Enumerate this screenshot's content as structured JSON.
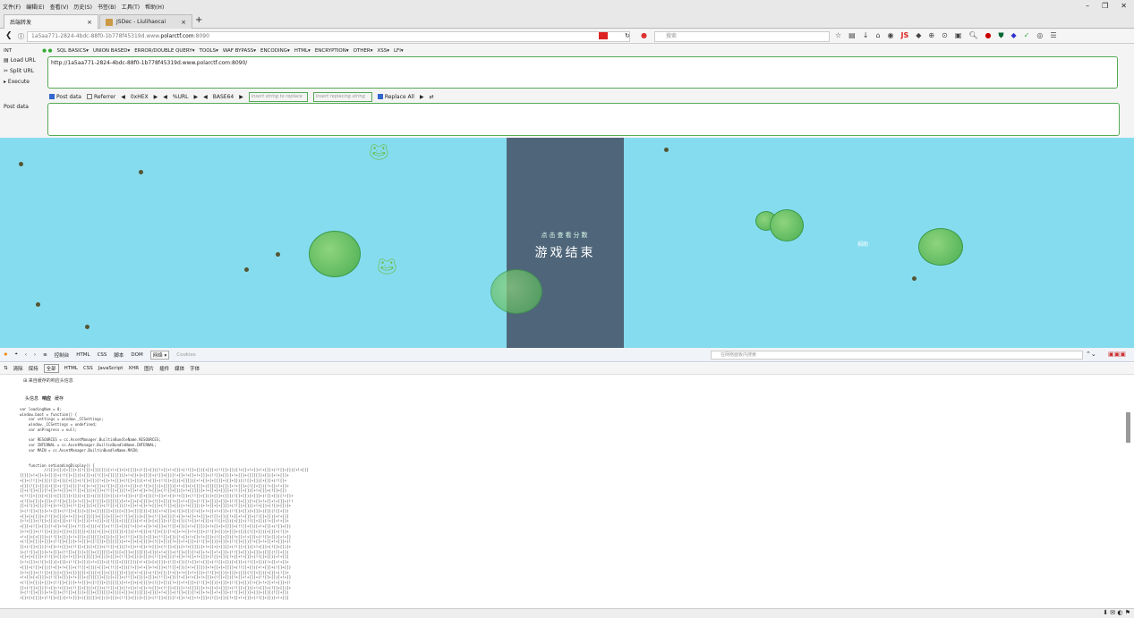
{
  "menubar": [
    "文件(F)",
    "编辑(E)",
    "查看(V)",
    "历史(S)",
    "书签(B)",
    "工具(T)",
    "帮助(H)"
  ],
  "window_controls": [
    "–",
    "❐",
    "✕"
  ],
  "tabs": [
    {
      "label": "后端转发",
      "active": true
    },
    {
      "label": "JSDec - Liulihaocai",
      "active": false
    }
  ],
  "nav": {
    "url_prefix": "1a5aa771-2824-4bdc-88f0-1b778f45319d.www.",
    "url_host": "polarctf.com",
    "url_suffix": ":8090",
    "search_placeholder": "搜索"
  },
  "hackbar": {
    "int_label": "INT",
    "menu": [
      "SQL BASICS▾",
      "UNION BASED▾",
      "ERROR/DOUBLE QUERY▾",
      "TOOLS▾",
      "WAF BYPASS▾",
      "ENCODING▾",
      "HTML▾",
      "ENCRYPTION▾",
      "OTHER▾",
      "XSS▾",
      "LFI▾"
    ],
    "load_url": "Load URL",
    "split_url": "Split URL",
    "execute": "Execute",
    "url_value": "http://1a5aa771-2824-4bdc-88f0-1b778f45319d.www.polarctf.com:8090/",
    "post_data_cb": "Post data",
    "referrer_cb": "Referrer",
    "hex": "0xHEX",
    "url_enc": "%URL",
    "base64": "BASE64",
    "insert_placeholder": "insert string to replace",
    "replacing_placeholder": "insert replacing string",
    "replace_all": "Replace All",
    "post_label": "Post data"
  },
  "game": {
    "score_hint": "点击查看分数",
    "game_over": "游戏结束",
    "side_label": "捐助"
  },
  "devtools": {
    "tabs": [
      "控制台",
      "HTML",
      "CSS",
      "脚本",
      "DOM",
      "网络 ▾",
      "Cookies"
    ],
    "active_tab": "网络 ▾",
    "search_placeholder": "在网络面板内搜索",
    "filters": [
      "清除",
      "保持",
      "全部",
      "HTML",
      "CSS",
      "JavaScript",
      "XHR",
      "图片",
      "插件",
      "媒体",
      "字体"
    ],
    "active_filter": "全部",
    "cache_note": "⊞ 来自缓存的响应头信息",
    "subtabs": [
      "头信息",
      "响应",
      "缓存"
    ],
    "active_subtab": "响应",
    "code": "var loadingNum = 0;\nwindow.boot = function() {\n    var settings = window._CCSettings;\n    window._CCSettings = undefined;\n    var onProgress = null;\n\n    var RESOURCES = cc.AssetManager.BuiltinBundleName.RESOURCES;\n    var INTERNAL = cc.AssetManager.BuiltinBundleName.INTERNAL;\n    var MAIN = cc.AssetManager.BuiltinBundleName.MAIN;\n\n\n    function setLoadingDisplay() {\n           //([]+[])[+[]]+([![]]+[][[]])[+!+[]+[+[]]]+(![]+[])[!+[]+!+[]]+(!![]+[])[+[]]+(!![]+[])[!+[]+!+[]+!+[]]+(!![]+[])[+!+[]]\n[[]][+!+[]+[+[]]]+(!![]+[])[+[]]+([![]]+[][[]])[+!+[]+[+[]]]+(![]+[])[!+[]+!+[]+!+[]]+(!![]+[])[+!+[]]+([][[]]+[])[+!+[]]+\n+[]+(!![]+[][(![]+[])[+[]]+(![]+[])[!+[]+!+[]]+(![]+[])[+!+[]]+(!![]+[])[+[]]])[+!+[]+[+[]]]+([]+[])[(![]+[])[+[]]+(!![]+\n+[][(![]+[])[+[]]+(![]+[])[!+[]+!+[]]+(![]+[])[+!+[]]+(!![]+[])[+[]]])[+!+[]+[+[]]]+([][[]]+[])[+!+[]]+(![]+[])[!+[]+!+[]+\n[]+(![]+[])[!+[]+!+[]]+(!![]+[])[+[]]+(!![]+[])[!+[]+!+[]+!+[]]+(!![]+[])[+!+[]]])[+!+[]+[+[]]]+(!![]+[])[+!+[]]+(![]+[])\n+(!![]+[])[+[]]+([][[]]+[])[+[]]+([][[]]+[])[+!+[]]+(![]+[])[!+[]+!+[]+!+[]]+(!![]+[])[+[]]+([][(![]+[])[+[]]+(![]+[])[!+[]+\n+(![]+[])[+[]]+(!![]+[])[+!+[]]+([![]]+[][[]])[+!+[]+[+[]]]+(![]+[])[!+[]+!+[]]+(!![]+[])[+[]]+(!![]+[])[!+[]+!+[]+!+[]]+(!!\n[]+(![]+[])[!+[]+!+[]]+(!![]+[])[+[]]+(!![]+[])[!+[]+!+[]+!+[]]+(!![]+[])[+!+[]]])[+!+[]+[+[]]]+(!![]+[])[+!+[]]+(![]+[])[+\n]+(!![]+[])[+!+[]]+(!![]+[])[+[]]+([][[]]+[])[+[]]+([][[]]+[])[+!+[]]+(![]+[])[!+[]+!+[]+!+[]]+(!![]+[])[+[]]+([][(![]+[])\n+[]+[+[]]]+(!![]+[])[+!+[]]+([][[]]+[])[+[]]+(!![]+[])[+[]]+(!![]+[])[!+[]+!+[]+!+[]]+(![]+[])[!+[]+!+[]]+(!![]+[])[+!+[]]\n[+!+[]]+(![]+[])[+[]]+(!![]+[])[+!+[]]+([![]]+[][[]])[+!+[]+[+[]]]+(![]+[])[!+[]+!+[]]+(!![]+[])[+[]]+(!![]+[])[!+[]+!+[]+\n+[]]+(![]+[])[!+[]+!+[]]+(!![]+[])[+[]]+(!![]+[])[!+[]+!+[]+!+[]]+(!![]+[])[+!+[]]])[+!+[]+[+[]]]+(!![]+[])[+!+[]]+(![]+[])\n[+!+[]]+(!![]+[])[+[]]+([][[]]+[])[+[]]+([][[]]+[])[+!+[]]+(![]+[])[!+[]+!+[]+!+[]]+(!![]+[])[+[]]+([][(![]+[])[+[]]+(![]+\n+!+[]+[+[]]]+(!![]+[])[+!+[]]+([][[]]+[])[+[]]+(!![]+[])[+[]]+(!![]+[])[!+[]+!+[]+!+[]]+(![]+[])[!+[]+!+[]]+(!![]+[])[+!+[]\n+(![]+[])[+[]]+(!![]+[])[+!+[]]+([![]]+[][[]])[+!+[]+[+[]]]+(![]+[])[!+[]+!+[]]+(!![]+[])[+[]]+(!![]+[])[!+[]+!+[]+!+[]]+(!\n[]+(![]+[])[!+[]+!+[]]+(!![]+[])[+[]]+(!![]+[])[!+[]+!+[]+!+[]]+(!![]+[])[+!+[]]])[+!+[]+[+[]]]+(!![]+[])[+!+[]]+(![]+[])[+\n]+(!![]+[])[+!+[]]+(!![]+[])[+[]]+([][[]]+[])[+[]]+([][[]]+[])[+!+[]]+(![]+[])[!+[]+!+[]+!+[]]+(!![]+[])[+[]]+([][(![]+[])\n+[]+[+[]]]+(!![]+[])[+!+[]]+([][[]]+[])[+[]]+(!![]+[])[+[]]+(!![]+[])[!+[]+!+[]+!+[]]+(![]+[])[!+[]+!+[]]+(!![]+[])[+!+[]]\n[+!+[]]+(![]+[])[+[]]+(!![]+[])[+!+[]]+([![]]+[][[]])[+!+[]+[+[]]]+(![]+[])[!+[]+!+[]]+(!![]+[])[+[]]+(!![]+[])[!+[]+!+[]+\n+[]]+(![]+[])[!+[]+!+[]]+(!![]+[])[+[]]+(!![]+[])[!+[]+!+[]+!+[]]+(!![]+[])[+!+[]]])[+!+[]+[+[]]]+(!![]+[])[+!+[]]+(![]+[])\n[+!+[]]+(!![]+[])[+[]]+([][[]]+[])[+[]]+([][[]]+[])[+!+[]]+(![]+[])[!+[]+!+[]+!+[]]+(!![]+[])[+[]]+([][(![]+[])[+[]]+(![]+\n+!+[]+[+[]]]+(!![]+[])[+!+[]]+([][[]]+[])[+[]]+(!![]+[])[+[]]+(!![]+[])[!+[]+!+[]+!+[]]+(![]+[])[!+[]+!+[]]+(!![]+[])[+!+[]\n+(![]+[])[+[]]+(!![]+[])[+!+[]]+([![]]+[][[]])[+!+[]+[+[]]]+(![]+[])[!+[]+!+[]]+(!![]+[])[+[]]+(!![]+[])[!+[]+!+[]+!+[]]+(!\n[]+(![]+[])[!+[]+!+[]]+(!![]+[])[+[]]+(!![]+[])[!+[]+!+[]+!+[]]+(!![]+[])[+!+[]]])[+!+[]+[+[]]]+(!![]+[])[+!+[]]+(![]+[])[+\n]+(!![]+[])[+!+[]]+(!![]+[])[+[]]+([][[]]+[])[+[]]+([][[]]+[])[+!+[]]+(![]+[])[!+[]+!+[]+!+[]]+(!![]+[])[+[]]+([][(![]+[])\n+[]+[+[]]]+(!![]+[])[+!+[]]+([][[]]+[])[+[]]+(!![]+[])[+[]]+(!![]+[])[!+[]+!+[]+!+[]]+(![]+[])[!+[]+!+[]]+(!![]+[])[+!+[]]"
  }
}
